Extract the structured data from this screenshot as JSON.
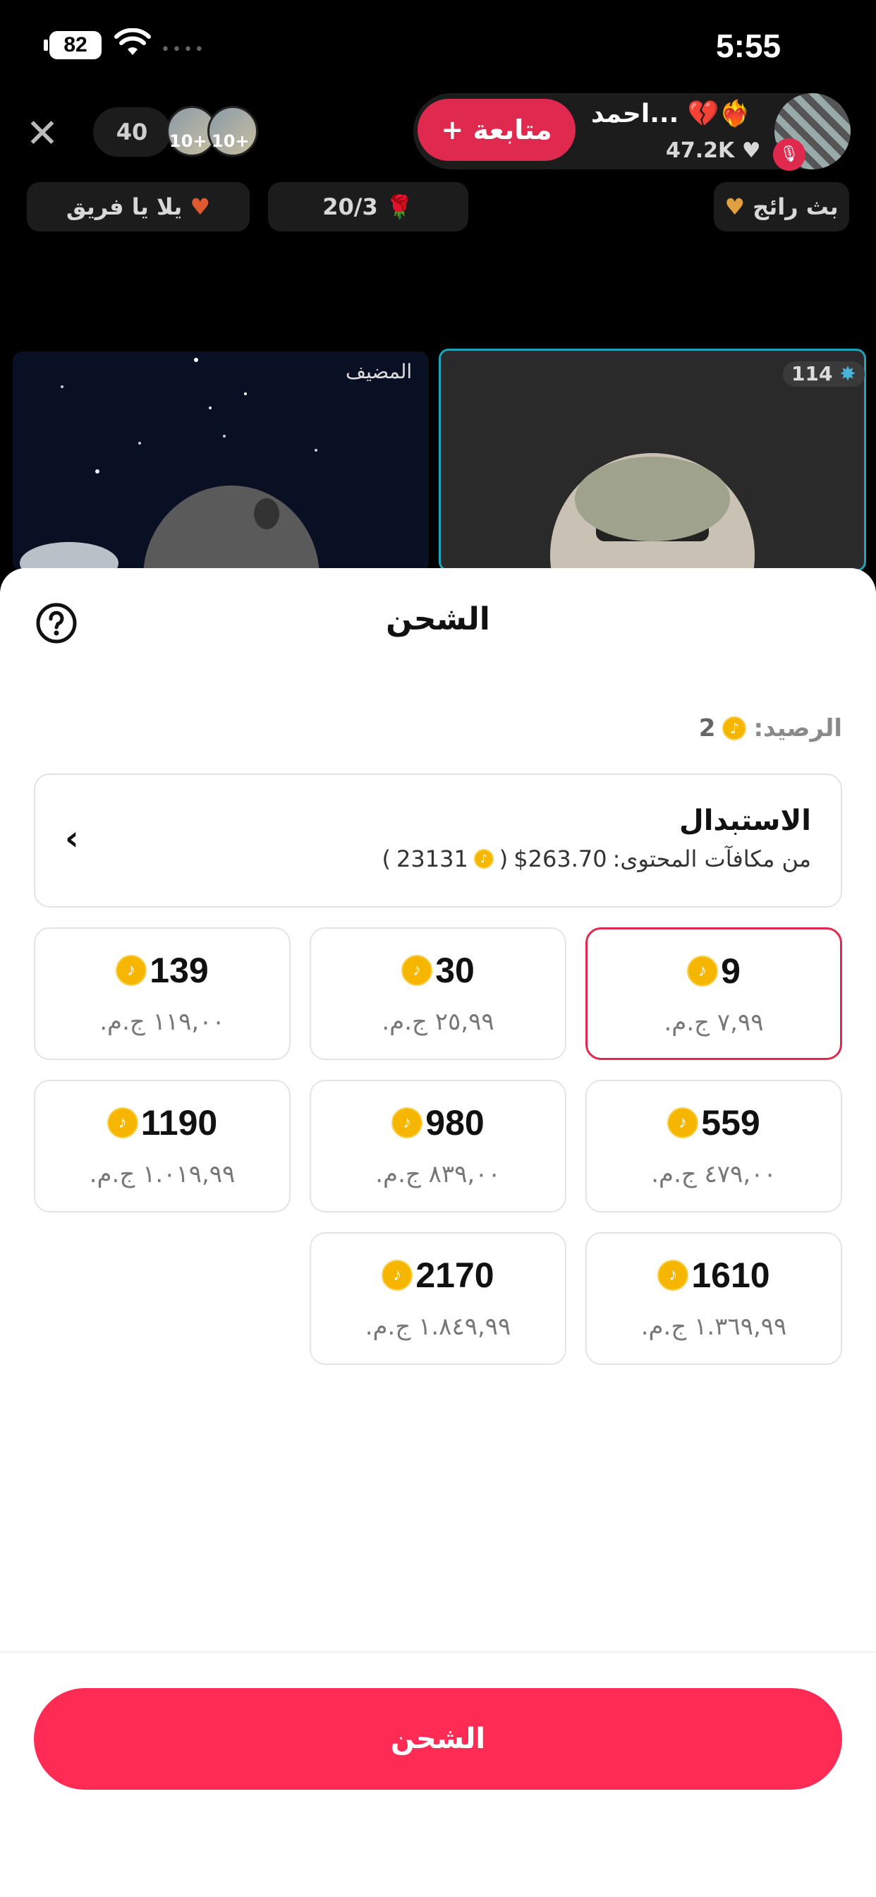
{
  "status_bar": {
    "time": "5:55",
    "battery": "82",
    "wifi_icon": "wifi-icon"
  },
  "live": {
    "viewer_count": "40",
    "viewer_badges": [
      "10+",
      "10+"
    ],
    "follow_label": "+ متابعة",
    "host_name": "احمد... 💔❤️‍🔥",
    "host_likes": "47.2K",
    "chips": {
      "awesome": "بث رائج",
      "rose_count": "20/3",
      "team": "يلا يا فريق"
    },
    "host_label": "المضيف",
    "tile_count": "114"
  },
  "sheet": {
    "title": "الشحن",
    "balance_label": "الرصيد:",
    "balance_value": "2",
    "exchange": {
      "title": "الاستبدال",
      "sub_label": "من مكافآت المحتوى:",
      "sub_value": "$263.70",
      "coins": "23131",
      "paren_open": "(",
      "paren_close": ")"
    },
    "packages": [
      {
        "amount": "9",
        "price": "٧,٩٩ ج.م."
      },
      {
        "amount": "30",
        "price": "٢٥,٩٩ ج.م."
      },
      {
        "amount": "139",
        "price": "١١٩,٠٠ ج.م."
      },
      {
        "amount": "559",
        "price": "٤٧٩,٠٠ ج.م."
      },
      {
        "amount": "980",
        "price": "٨٣٩,٠٠ ج.م."
      },
      {
        "amount": "1190",
        "price": "١.٠١٩,٩٩ ج.م."
      },
      {
        "amount": "1610",
        "price": "١.٣٦٩,٩٩ ج.م."
      },
      {
        "amount": "2170",
        "price": "١.٨٤٩,٩٩ ج.م."
      }
    ],
    "selected_package": "9",
    "recharge_label": "الشحن"
  },
  "colors": {
    "accent": "#fe2c55",
    "coin": "#f6b600",
    "tile_border": "#1ea3b8"
  }
}
